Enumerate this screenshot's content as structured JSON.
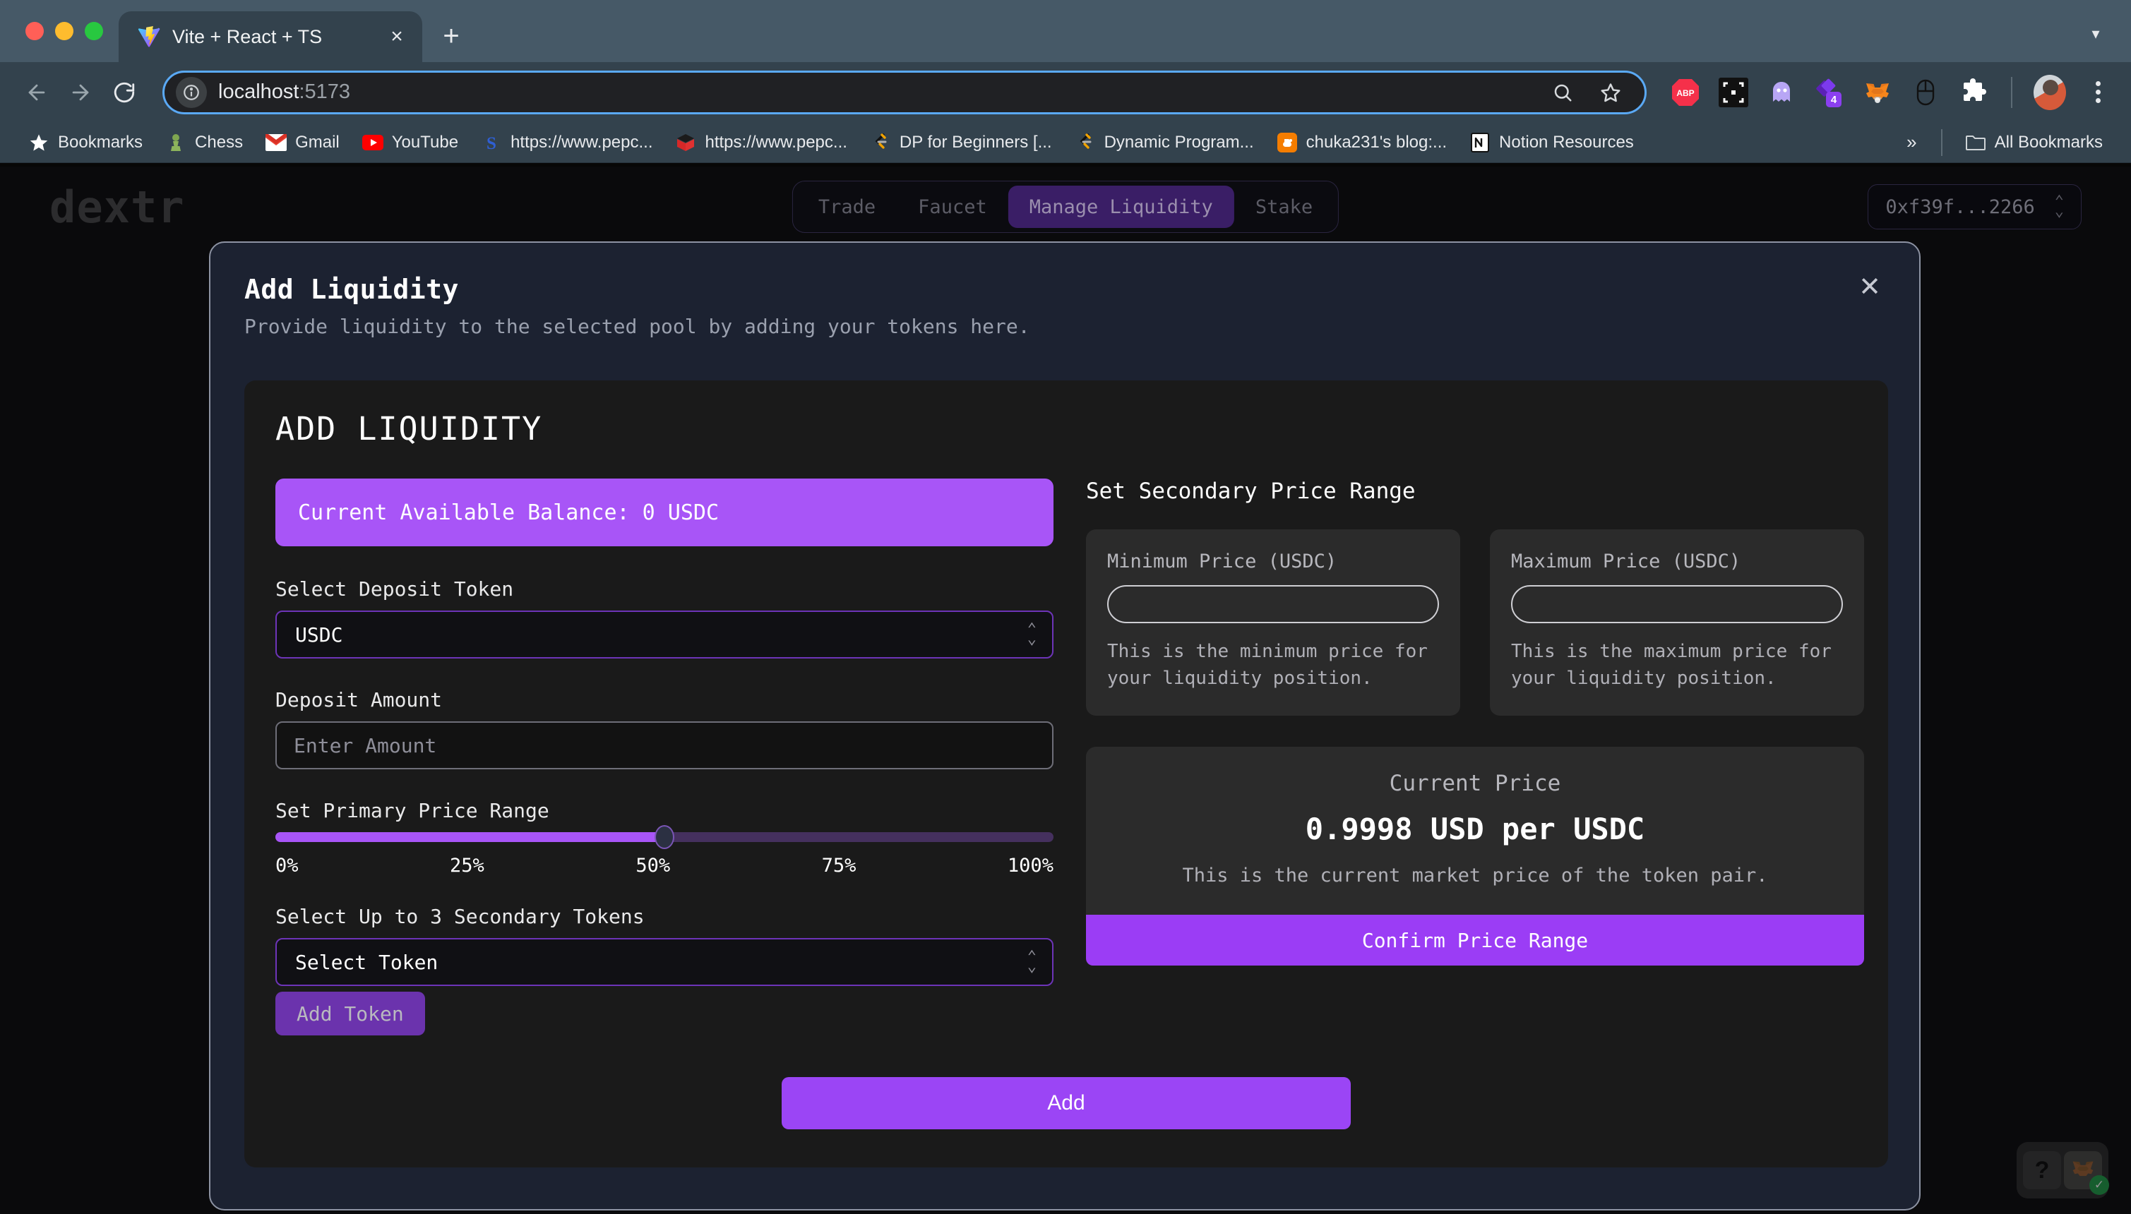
{
  "browser": {
    "tab": {
      "title": "Vite + React + TS",
      "favicon": "vite-logo-icon",
      "close": "×"
    },
    "newtab_label": "+",
    "tabstrip_chevron": "▾",
    "nav": {
      "back": "←",
      "forward": "→",
      "reload": "↻"
    },
    "omnibox": {
      "info_icon": "ⓘ",
      "url_host": "localhost",
      "url_port": ":5173",
      "search_icon": "search-icon",
      "bookmark_icon": "star-icon"
    },
    "extensions": [
      {
        "name": "adblock-plus-icon",
        "label": "ABP"
      },
      {
        "name": "screenshot-crop-icon",
        "label": ""
      },
      {
        "name": "ghostery-icon",
        "label": ""
      },
      {
        "name": "purple-extension-icon",
        "label": "",
        "badge": "4"
      },
      {
        "name": "metamask-fox-icon",
        "label": ""
      },
      {
        "name": "mouse-extension-icon",
        "label": ""
      },
      {
        "name": "extensions-puzzle-icon",
        "label": ""
      }
    ],
    "profile_icon": "avatar",
    "menu_icon": "kebab-menu-icon",
    "bookmarks": [
      {
        "label": "Bookmarks",
        "icon": "star-icon"
      },
      {
        "label": "Chess",
        "icon": "chess-pawn-icon"
      },
      {
        "label": "Gmail",
        "icon": "gmail-icon"
      },
      {
        "label": "YouTube",
        "icon": "youtube-icon"
      },
      {
        "label": "https://www.pepc...",
        "icon": "stripe-s-icon"
      },
      {
        "label": "https://www.pepc...",
        "icon": "red-cube-icon"
      },
      {
        "label": "DP for Beginners [...",
        "icon": "leetcode-icon"
      },
      {
        "label": "Dynamic Program...",
        "icon": "leetcode-icon"
      },
      {
        "label": "chuka231's blog:...",
        "icon": "blogger-icon"
      },
      {
        "label": "Notion Resources",
        "icon": "notion-icon"
      }
    ],
    "overflow_label": "»",
    "all_bookmarks_label": "All Bookmarks",
    "all_bookmarks_icon": "folder-icon"
  },
  "app": {
    "logo": "dextr",
    "nav_tabs": [
      {
        "label": "Trade",
        "active": false
      },
      {
        "label": "Faucet",
        "active": false
      },
      {
        "label": "Manage Liquidity",
        "active": true
      },
      {
        "label": "Stake",
        "active": false
      }
    ],
    "wallet_address": "0xf39f...2266"
  },
  "modal": {
    "title": "Add Liquidity",
    "subtitle": "Provide liquidity to the selected pool by adding your tokens here.",
    "close_label": "✕",
    "card_title": "ADD LIQUIDITY",
    "left": {
      "balance_banner": "Current Available Balance: 0 USDC",
      "deposit_token_label": "Select Deposit Token",
      "deposit_token_value": "USDC",
      "deposit_amount_label": "Deposit Amount",
      "deposit_amount_value": "",
      "deposit_amount_placeholder": "Enter Amount",
      "primary_range_label": "Set Primary Price Range",
      "slider_value": 50,
      "slider_ticks": [
        "0%",
        "25%",
        "50%",
        "75%",
        "100%"
      ],
      "secondary_tokens_label": "Select Up to 3 Secondary Tokens",
      "secondary_tokens_value": "Select Token",
      "add_token_label": "Add Token"
    },
    "right": {
      "section_title": "Set Secondary Price Range",
      "min_price": {
        "label": "Minimum Price (USDC)",
        "value": "",
        "hint": "This is the minimum price for your liquidity position."
      },
      "max_price": {
        "label": "Maximum Price (USDC)",
        "value": "",
        "hint": "This is the maximum price for your liquidity position."
      },
      "current_price": {
        "label": "Current Price",
        "value": "0.9998 USD per USDC",
        "hint": "This is the current market price of the token pair.",
        "confirm_label": "Confirm Price Range"
      }
    },
    "submit_label": "Add"
  },
  "help_widget": {
    "question_label": "?",
    "wallet_icon": "metamask-fox-icon",
    "status_icon": "✓"
  },
  "colors": {
    "accent_purple": "#a855f7",
    "accent_purple_dark": "#6b33ad",
    "modal_bg": "#1c2231",
    "card_bg": "#1a1a1a",
    "panel_bg": "#2b2b2b",
    "browser_chrome": "#33424d",
    "connected_green": "#21a14b"
  }
}
